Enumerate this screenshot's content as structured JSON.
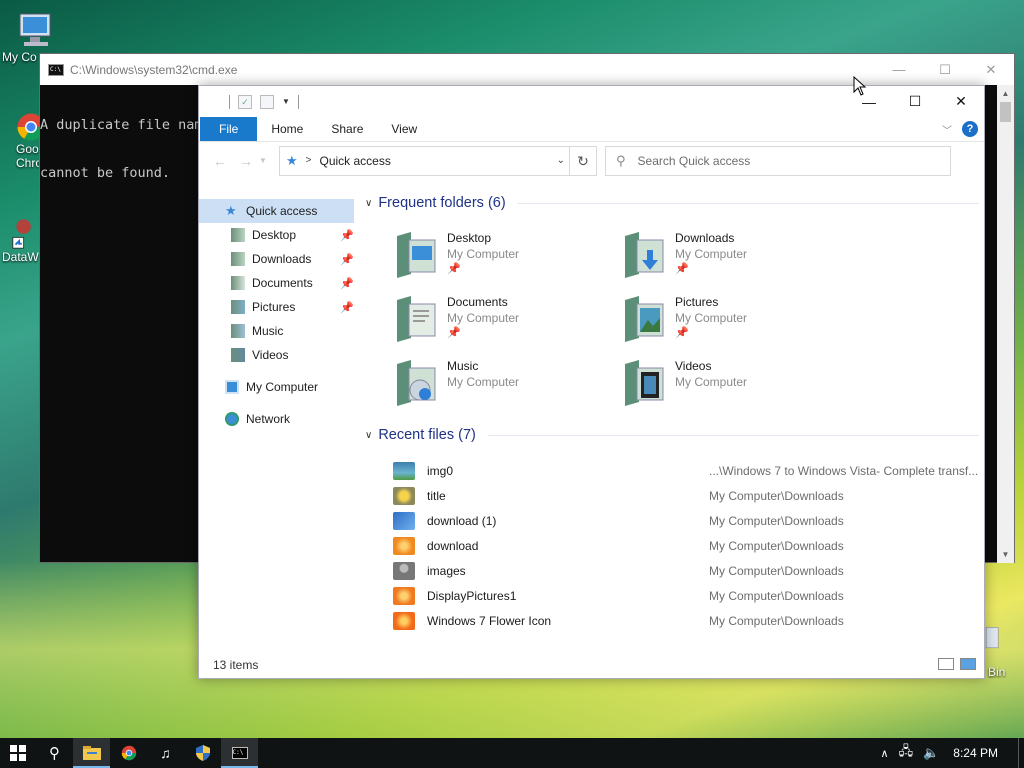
{
  "desktop": {
    "icons": [
      {
        "label": "My Co",
        "icon": "computer-icon"
      },
      {
        "label": "Goo Chro",
        "icon": "chrome-icon"
      },
      {
        "label": "DataW",
        "icon": "datawrapper-icon"
      },
      {
        "label": "Bin",
        "icon": "recycle-bin-icon"
      }
    ]
  },
  "cmd": {
    "title": "C:\\Windows\\system32\\cmd.exe",
    "lines": [
      "A duplicate file nam",
      "cannot be found."
    ],
    "controls": {
      "minimize": "—",
      "maximize": "☐",
      "close": "✕"
    }
  },
  "explorer": {
    "controls": {
      "minimize": "—",
      "maximize": "☐",
      "close": "✕"
    },
    "ribbon_tabs": [
      "File",
      "Home",
      "Share",
      "View"
    ],
    "address": {
      "location": "Quick access",
      "separator": ">"
    },
    "search_placeholder": "Search Quick access",
    "nav": {
      "quick_access": "Quick access",
      "pinned": [
        {
          "label": "Desktop",
          "pinned": true
        },
        {
          "label": "Downloads",
          "pinned": true
        },
        {
          "label": "Documents",
          "pinned": true
        },
        {
          "label": "Pictures",
          "pinned": true
        },
        {
          "label": "Music",
          "pinned": false
        },
        {
          "label": "Videos",
          "pinned": false
        }
      ],
      "my_computer": "My Computer",
      "network": "Network"
    },
    "frequent": {
      "heading": "Frequent folders (6)",
      "folders": [
        {
          "name": "Desktop",
          "location": "My Computer",
          "pinned": true,
          "icon": "desktop-folder-icon"
        },
        {
          "name": "Downloads",
          "location": "My Computer",
          "pinned": true,
          "icon": "downloads-folder-icon"
        },
        {
          "name": "Documents",
          "location": "My Computer",
          "pinned": true,
          "icon": "documents-folder-icon"
        },
        {
          "name": "Pictures",
          "location": "My Computer",
          "pinned": true,
          "icon": "pictures-folder-icon"
        },
        {
          "name": "Music",
          "location": "My Computer",
          "pinned": false,
          "icon": "music-folder-icon"
        },
        {
          "name": "Videos",
          "location": "My Computer",
          "pinned": false,
          "icon": "videos-folder-icon"
        }
      ]
    },
    "recent": {
      "heading": "Recent files (7)",
      "files": [
        {
          "name": "img0",
          "path": "...\\Windows 7 to Windows Vista- Complete transf...",
          "color": "#3c7fb0"
        },
        {
          "name": "title",
          "path": "My Computer\\Downloads",
          "color": "#8c8a5a"
        },
        {
          "name": "download (1)",
          "path": "My Computer\\Downloads",
          "color": "#2f6fc4"
        },
        {
          "name": "download",
          "path": "My Computer\\Downloads",
          "color": "#f08a20"
        },
        {
          "name": "images",
          "path": "My Computer\\Downloads",
          "color": "#777777"
        },
        {
          "name": "DisplayPictures1",
          "path": "My Computer\\Downloads",
          "color": "#f07a20"
        },
        {
          "name": "Windows 7 Flower Icon",
          "path": "My Computer\\Downloads",
          "color": "#f26a1a"
        }
      ]
    },
    "status": "13 items"
  },
  "taskbar": {
    "clock": "8:24 PM",
    "buttons": [
      "start-icon",
      "search-icon",
      "file-explorer-icon",
      "chrome-icon",
      "music-app-icon",
      "shield-icon",
      "cmd-icon"
    ]
  }
}
